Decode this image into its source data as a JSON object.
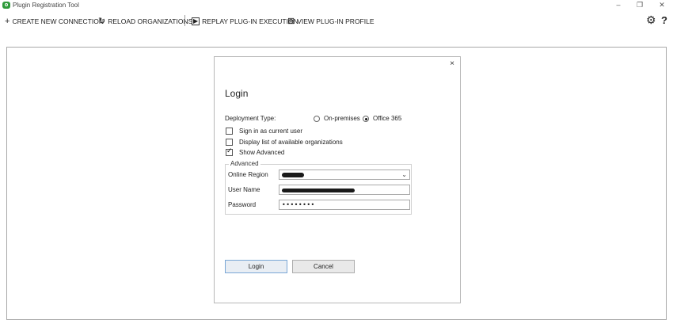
{
  "window": {
    "title": "Plugin Registration Tool",
    "controls": {
      "minimize": "–",
      "restore": "❐",
      "close": "✕"
    }
  },
  "toolbar": {
    "items": [
      {
        "icon": "+",
        "label": "CREATE NEW CONNECTION"
      },
      {
        "icon": "↻",
        "label": "RELOAD ORGANIZATIONS"
      },
      {
        "icon": "▶",
        "label": "REPLAY PLUG-IN EXECUTION"
      },
      {
        "icon": "⊞",
        "label": "VIEW PLUG-IN PROFILE"
      }
    ],
    "settings_icon": "⚙",
    "help_icon": "?"
  },
  "login_dialog": {
    "close_glyph": "×",
    "title": "Login",
    "deployment_type": {
      "label": "Deployment Type:",
      "options": [
        {
          "label": "On-premises",
          "selected": false
        },
        {
          "label": "Office 365",
          "selected": true
        }
      ]
    },
    "checkboxes": [
      {
        "label": "Sign in as current user",
        "checked": false
      },
      {
        "label": "Display list of available organizations",
        "checked": false
      },
      {
        "label": "Show Advanced",
        "checked": true
      }
    ],
    "advanced": {
      "legend": "Advanced",
      "online_region_label": "Online Region",
      "user_name_label": "User Name",
      "password_label": "Password",
      "password_value": "••••••••"
    },
    "login_button": "Login",
    "cancel_button": "Cancel"
  }
}
